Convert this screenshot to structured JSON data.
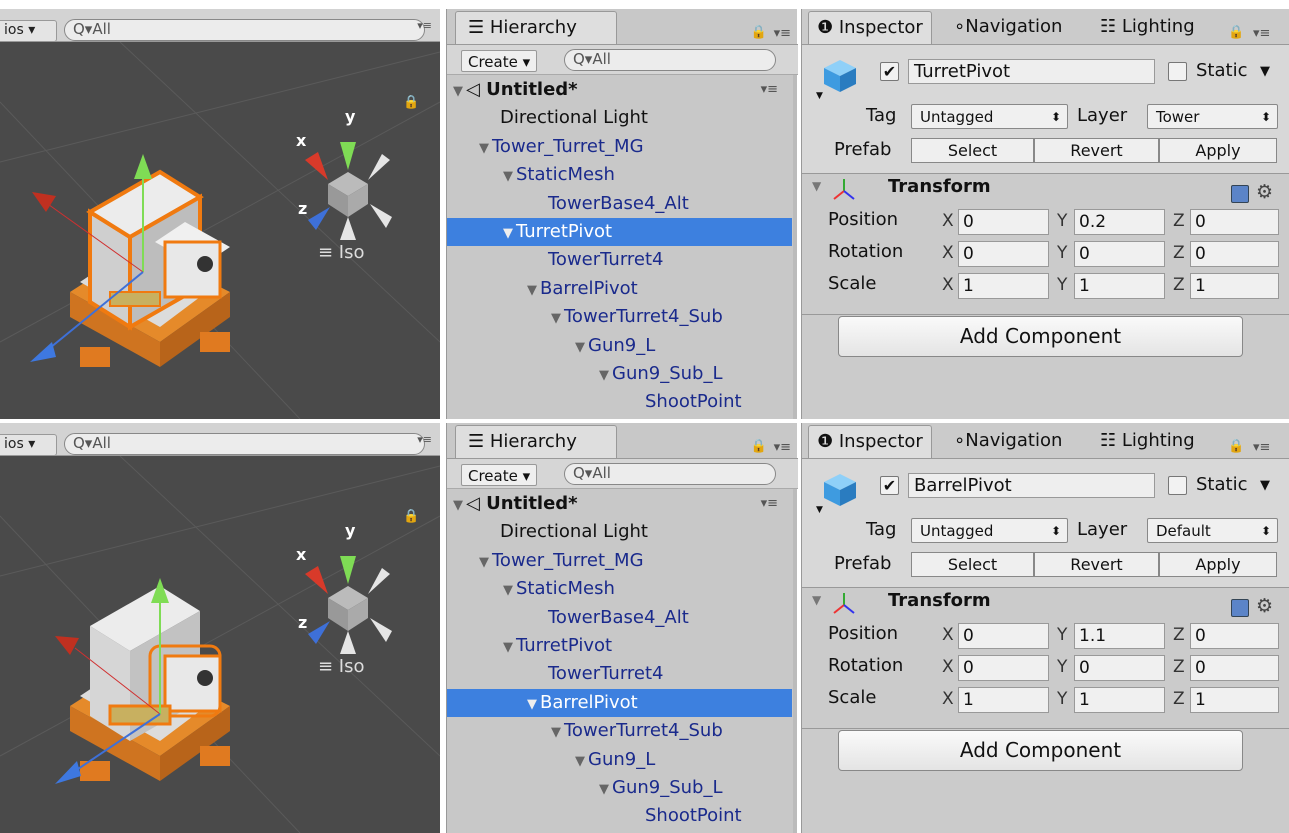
{
  "shared": {
    "gizmos_label": "ios ▾",
    "search_placeholder": "Q▾All",
    "iso_label": "≡ Iso",
    "hierarchy_tab": "Hierarchy",
    "create_label": "Create ▾",
    "inspector_tab": "Inspector",
    "navigation_tab": "Navigation",
    "lighting_tab": "Lighting",
    "static_label": "Static",
    "tag_label": "Tag",
    "layer_label": "Layer",
    "prefab_label": "Prefab",
    "select_label": "Select",
    "revert_label": "Revert",
    "apply_label": "Apply",
    "transform_label": "Transform",
    "position_label": "Position",
    "rotation_label": "Rotation",
    "scale_label": "Scale",
    "add_component_label": "Add Component",
    "axis_x": "X",
    "axis_y": "Y",
    "axis_z": "Z",
    "gizmo_x": "x",
    "gizmo_y": "y",
    "gizmo_z": "z"
  },
  "panels": [
    {
      "tree": [
        {
          "label": "Untitled*"
        },
        {
          "label": "Directional Light"
        },
        {
          "label": "Tower_Turret_MG"
        },
        {
          "label": "StaticMesh"
        },
        {
          "label": "TowerBase4_Alt"
        },
        {
          "label": "TurretPivot"
        },
        {
          "label": "TowerTurret4"
        },
        {
          "label": "BarrelPivot"
        },
        {
          "label": "TowerTurret4_Sub"
        },
        {
          "label": "Gun9_L"
        },
        {
          "label": "Gun9_Sub_L"
        },
        {
          "label": "ShootPoint"
        }
      ],
      "object_name": "TurretPivot",
      "tag": "Untagged",
      "layer": "Tower",
      "position": {
        "x": "0",
        "y": "0.2",
        "z": "0"
      },
      "rotation": {
        "x": "0",
        "y": "0",
        "z": "0"
      },
      "scale": {
        "x": "1",
        "y": "1",
        "z": "1"
      }
    },
    {
      "tree": [
        {
          "label": "Untitled*"
        },
        {
          "label": "Directional Light"
        },
        {
          "label": "Tower_Turret_MG"
        },
        {
          "label": "StaticMesh"
        },
        {
          "label": "TowerBase4_Alt"
        },
        {
          "label": "TurretPivot"
        },
        {
          "label": "TowerTurret4"
        },
        {
          "label": "BarrelPivot"
        },
        {
          "label": "TowerTurret4_Sub"
        },
        {
          "label": "Gun9_L"
        },
        {
          "label": "Gun9_Sub_L"
        },
        {
          "label": "ShootPoint"
        }
      ],
      "object_name": "BarrelPivot",
      "tag": "Untagged",
      "layer": "Default",
      "position": {
        "x": "0",
        "y": "1.1",
        "z": "0"
      },
      "rotation": {
        "x": "0",
        "y": "0",
        "z": "0"
      },
      "scale": {
        "x": "1",
        "y": "1",
        "z": "1"
      }
    }
  ]
}
